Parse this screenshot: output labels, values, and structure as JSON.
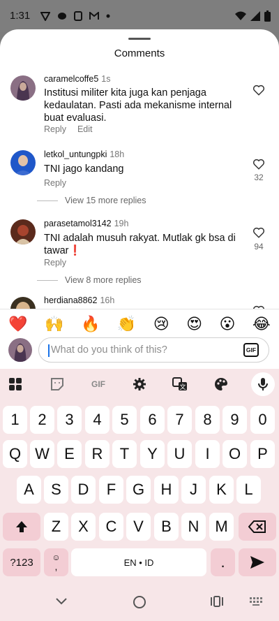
{
  "status_bar": {
    "time": "1:31"
  },
  "sheet": {
    "title": "Comments"
  },
  "comments": [
    {
      "user": "caramelcoffe5",
      "time": "1s",
      "text": "Institusi militer kita juga kan penjaga kedaulatan. Pasti ada mekanisme internal buat evaluasi.",
      "actions": [
        "Reply",
        "Edit"
      ],
      "likes": ""
    },
    {
      "user": "letkol_untungpki",
      "time": "18h",
      "text": "TNI jago kandang",
      "actions": [
        "Reply"
      ],
      "likes": "32",
      "more_replies": "View 15 more replies"
    },
    {
      "user": "parasetamol3142",
      "time": "19h",
      "text": "TNI adalah musuh rakyat. Mutlak gk bsa di tawar❗",
      "actions": [
        "Reply"
      ],
      "likes": "94",
      "more_replies": "View 8 more replies"
    },
    {
      "user": "herdiana8862",
      "time": "16h",
      "text": "",
      "actions": [],
      "likes": ""
    }
  ],
  "reactions": [
    "❤️",
    "🙌",
    "🔥",
    "👏",
    "😢",
    "😍",
    "😮",
    "😂"
  ],
  "composer": {
    "placeholder": "What do you think of this?",
    "gif_label": "GIF"
  },
  "keyboard": {
    "toolbar_gif": "GIF",
    "rows": {
      "numbers": [
        "1",
        "2",
        "3",
        "4",
        "5",
        "6",
        "7",
        "8",
        "9",
        "0"
      ],
      "row1": [
        "Q",
        "W",
        "E",
        "R",
        "T",
        "Y",
        "U",
        "I",
        "O",
        "P"
      ],
      "row2": [
        "A",
        "S",
        "D",
        "F",
        "G",
        "H",
        "J",
        "K",
        "L"
      ],
      "row3": [
        "Z",
        "X",
        "C",
        "V",
        "B",
        "N",
        "M"
      ]
    },
    "symbols_key": "?123",
    "comma_key": ",",
    "space_label": "EN • ID",
    "period_key": "."
  },
  "colors": {
    "keyboard_bg": "#f7e6e8",
    "special_key": "#f3cdd4",
    "reaction_heart": "#e0245e"
  }
}
